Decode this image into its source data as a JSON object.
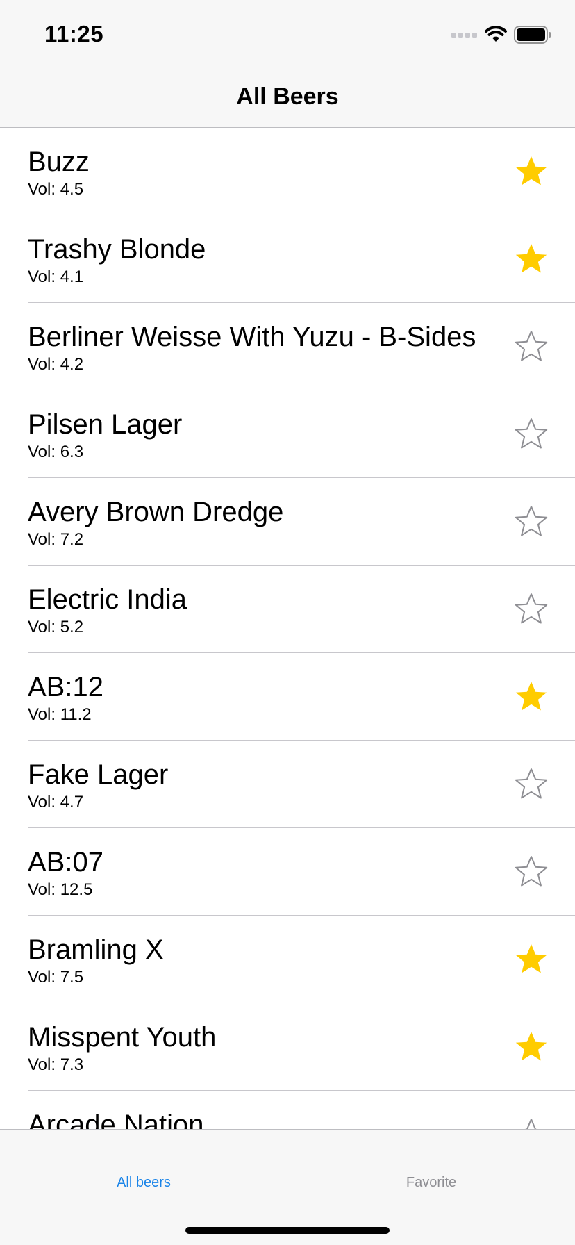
{
  "status_bar": {
    "time": "11:25"
  },
  "nav": {
    "title": "All Beers"
  },
  "colors": {
    "favorite_star": "#ffcc00",
    "empty_star": "#8e8e93",
    "tab_active": "#1a84e8",
    "tab_inactive": "#8e8e93"
  },
  "beers": [
    {
      "name": "Buzz",
      "vol": "Vol: 4.5",
      "favorite": true
    },
    {
      "name": "Trashy Blonde",
      "vol": "Vol: 4.1",
      "favorite": true
    },
    {
      "name": "Berliner Weisse With Yuzu - B-Sides",
      "vol": "Vol: 4.2",
      "favorite": false
    },
    {
      "name": "Pilsen Lager",
      "vol": "Vol: 6.3",
      "favorite": false
    },
    {
      "name": "Avery Brown Dredge",
      "vol": "Vol: 7.2",
      "favorite": false
    },
    {
      "name": "Electric India",
      "vol": "Vol: 5.2",
      "favorite": false
    },
    {
      "name": "AB:12",
      "vol": "Vol: 11.2",
      "favorite": true
    },
    {
      "name": "Fake Lager",
      "vol": "Vol: 4.7",
      "favorite": false
    },
    {
      "name": "AB:07",
      "vol": "Vol: 12.5",
      "favorite": false
    },
    {
      "name": "Bramling X",
      "vol": "Vol: 7.5",
      "favorite": true
    },
    {
      "name": "Misspent Youth",
      "vol": "Vol: 7.3",
      "favorite": true
    },
    {
      "name": "Arcade Nation",
      "vol": "",
      "favorite": false
    }
  ],
  "tabs": [
    {
      "label": "All beers",
      "active": true
    },
    {
      "label": "Favorite",
      "active": false
    }
  ]
}
